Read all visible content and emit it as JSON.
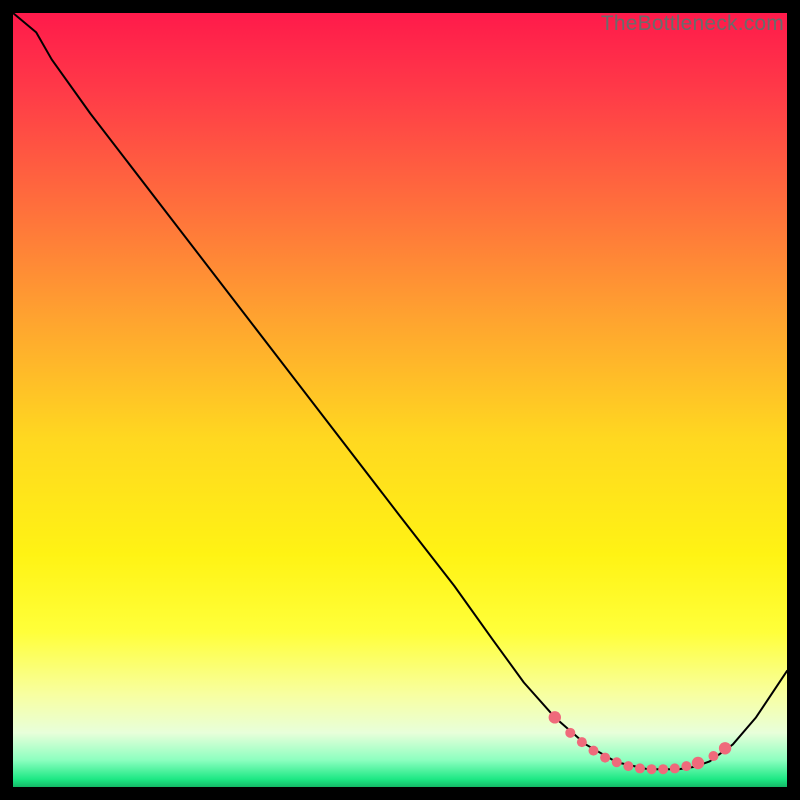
{
  "watermark": "TheBottleneck.com",
  "chart_data": {
    "type": "line",
    "title": "",
    "xlabel": "",
    "ylabel": "",
    "xlim": [
      0,
      100
    ],
    "ylim": [
      0,
      100
    ],
    "grid": false,
    "legend": false,
    "background_gradient": {
      "stops": [
        {
          "offset": 0.0,
          "color": "#ff1a4b"
        },
        {
          "offset": 0.1,
          "color": "#ff3a48"
        },
        {
          "offset": 0.25,
          "color": "#ff6f3c"
        },
        {
          "offset": 0.4,
          "color": "#ffa52f"
        },
        {
          "offset": 0.55,
          "color": "#ffd820"
        },
        {
          "offset": 0.7,
          "color": "#fff314"
        },
        {
          "offset": 0.8,
          "color": "#ffff3a"
        },
        {
          "offset": 0.88,
          "color": "#f8ffa0"
        },
        {
          "offset": 0.93,
          "color": "#e8ffda"
        },
        {
          "offset": 0.965,
          "color": "#8dffc0"
        },
        {
          "offset": 0.99,
          "color": "#1de884"
        },
        {
          "offset": 1.0,
          "color": "#14b866"
        }
      ]
    },
    "series": [
      {
        "name": "curve",
        "stroke": "#000000",
        "stroke_width": 2,
        "x": [
          0,
          3,
          5,
          10,
          20,
          30,
          40,
          50,
          57,
          62,
          66,
          70,
          74,
          78,
          82,
          86,
          88,
          90,
          93,
          96,
          100
        ],
        "y": [
          100,
          97.5,
          94,
          87,
          74,
          61,
          48,
          35,
          26,
          19,
          13.5,
          9,
          5.5,
          3.2,
          2.3,
          2.3,
          2.6,
          3.3,
          5.5,
          9,
          15
        ]
      }
    ],
    "markers": {
      "name": "highlight-band",
      "color": "#ef6a7b",
      "radius_small": 5,
      "radius_large": 6.2,
      "points": [
        {
          "x": 70,
          "y": 9,
          "r": "large"
        },
        {
          "x": 72,
          "y": 7,
          "r": "small"
        },
        {
          "x": 73.5,
          "y": 5.8,
          "r": "small"
        },
        {
          "x": 75,
          "y": 4.7,
          "r": "small"
        },
        {
          "x": 76.5,
          "y": 3.8,
          "r": "small"
        },
        {
          "x": 78,
          "y": 3.2,
          "r": "small"
        },
        {
          "x": 79.5,
          "y": 2.7,
          "r": "small"
        },
        {
          "x": 81,
          "y": 2.4,
          "r": "small"
        },
        {
          "x": 82.5,
          "y": 2.3,
          "r": "small"
        },
        {
          "x": 84,
          "y": 2.3,
          "r": "small"
        },
        {
          "x": 85.5,
          "y": 2.4,
          "r": "small"
        },
        {
          "x": 87,
          "y": 2.7,
          "r": "small"
        },
        {
          "x": 88.5,
          "y": 3.1,
          "r": "large"
        },
        {
          "x": 90.5,
          "y": 4.0,
          "r": "small"
        },
        {
          "x": 92,
          "y": 5.0,
          "r": "large"
        }
      ]
    }
  }
}
